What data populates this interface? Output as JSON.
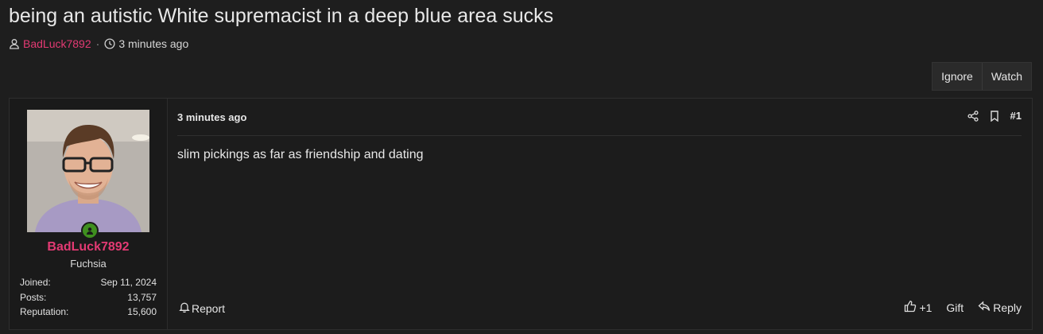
{
  "thread": {
    "title": "being an autistic White supremacist in a deep blue area sucks",
    "author": "BadLuck7892",
    "separator": "·",
    "posted": "3 minutes ago"
  },
  "thread_actions": {
    "ignore_label": "Ignore",
    "watch_label": "Watch"
  },
  "post": {
    "username": "BadLuck7892",
    "user_title": "Fuchsia",
    "stats": [
      {
        "label": "Joined:",
        "value": "Sep 11, 2024"
      },
      {
        "label": "Posts:",
        "value": "13,757"
      },
      {
        "label": "Reputation:",
        "value": "15,600"
      }
    ],
    "date": "3 minutes ago",
    "number": "#1",
    "body": "slim pickings as far as friendship and dating",
    "report_label": "Report",
    "like_label": "+1",
    "gift_label": "Gift",
    "reply_label": "Reply"
  },
  "icons": {
    "user": "user-icon",
    "clock": "clock-icon",
    "share": "share-icon",
    "bookmark": "bookmark-icon",
    "bell": "bell-icon",
    "thumbs_up": "thumbs-up-icon",
    "reply": "reply-icon"
  },
  "colors": {
    "background": "#1e1e1e",
    "username_accent": "#e33a73",
    "online_badge": "#3f8f1f"
  }
}
